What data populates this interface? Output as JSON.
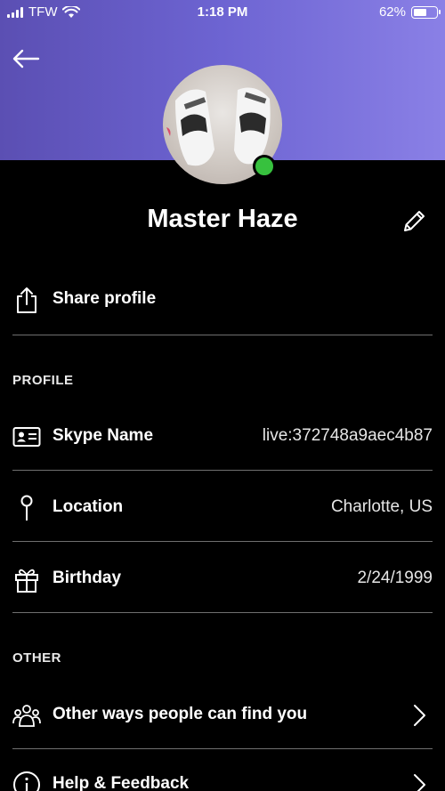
{
  "status": {
    "carrier": "TFW",
    "time": "1:18 PM",
    "battery": "62%",
    "battery_level": 0.62
  },
  "profile": {
    "name": "Master Haze"
  },
  "actions": {
    "share": "Share profile"
  },
  "sections": {
    "profile_title": "PROFILE",
    "other_title": "OTHER"
  },
  "fields": {
    "skype_name": {
      "label": "Skype Name",
      "value": "live:372748a9aec4b87"
    },
    "location": {
      "label": "Location",
      "value": "Charlotte, US"
    },
    "birthday": {
      "label": "Birthday",
      "value": "2/24/1999"
    }
  },
  "other": {
    "find_you": "Other ways people can find you",
    "help": "Help & Feedback"
  },
  "colors": {
    "header_start": "#5b4fb3",
    "header_end": "#8a80e6",
    "presence": "#37c13e",
    "background": "#000000"
  }
}
